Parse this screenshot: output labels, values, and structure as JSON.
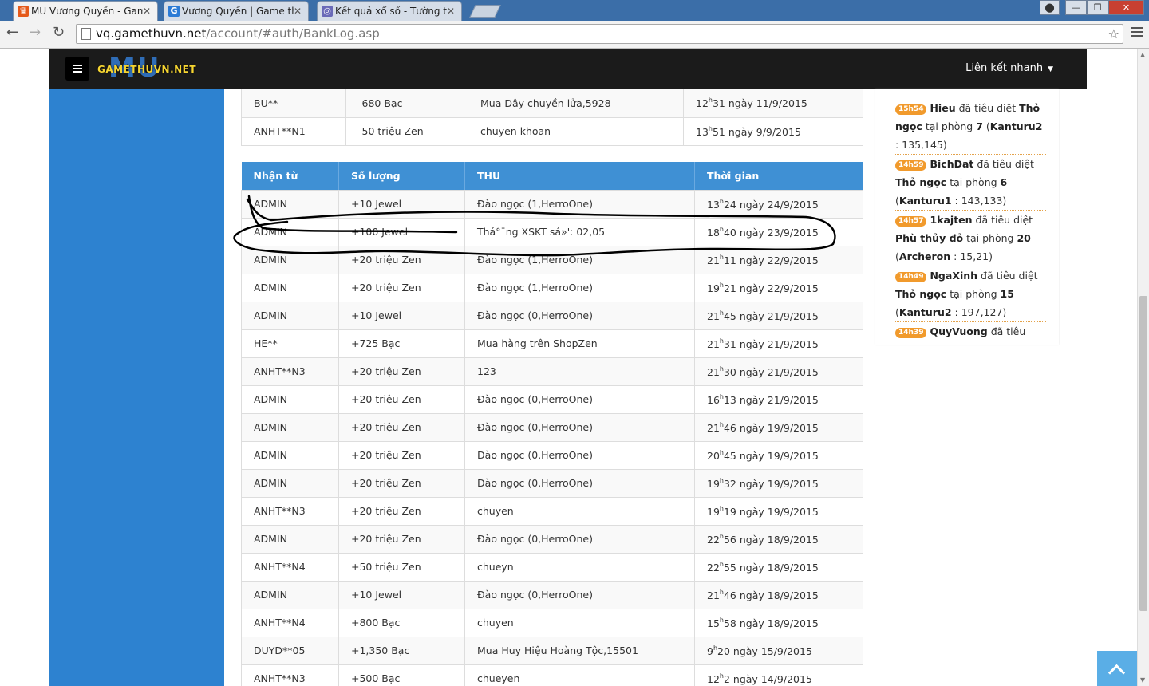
{
  "browser": {
    "tabs": [
      {
        "title": "MU Vương Quyền - Game",
        "favicon_color": "#e55a1a",
        "favicon_glyph": "♛",
        "active": true
      },
      {
        "title": "Vương Quyền | Game thủ",
        "favicon_color": "#2b7bd6",
        "favicon_glyph": "G",
        "active": false
      },
      {
        "title": "Kết quả xổ số - Tường thu",
        "favicon_color": "#6a6ab8",
        "favicon_glyph": "◎",
        "active": false
      }
    ],
    "tab_close": "✕",
    "url_host": "vq.gamethuvn.net",
    "url_path": "/account/#auth/BankLog.asp",
    "window_buttons": {
      "minimize": "—",
      "maximize": "❐",
      "close": "✕"
    },
    "icons": {
      "back": "back-arrow-icon",
      "forward": "forward-arrow-icon",
      "reload": "reload-icon",
      "star": "bookmark-star-icon",
      "menu": "chrome-menu-icon"
    }
  },
  "site": {
    "logo_mu": "MU",
    "logo_text": "GAMETHUVN.NET",
    "quick_links": "Liên kết nhanh",
    "colors": {
      "nav": "#1b1b1b",
      "side_panel": "#2d82d0",
      "table_header": "#3f90d4",
      "badge": "#f19a2c"
    }
  },
  "sent_log": {
    "rows": [
      {
        "user": "BU**",
        "amount": "-680  Bạc",
        "note": "Mua Dây chuyền lửa,5928",
        "hour": "12",
        "min": "31",
        "date": " ngày 11/9/2015"
      },
      {
        "user": "ANHT**N1",
        "amount": "-50  triệu Zen",
        "note": "chuyen khoan",
        "hour": "13",
        "min": "51",
        "date": " ngày 9/9/2015"
      }
    ]
  },
  "received_log": {
    "headers": {
      "from": "Nhận từ",
      "amount": "Số lượng",
      "subject": "THU",
      "time": "Thời gian"
    },
    "rows": [
      {
        "user": "ADMIN",
        "amount": "+10  Jewel",
        "note": "Đào ngọc (1,HerroOne)",
        "hour": "13",
        "min": "24",
        "date": " ngày 24/9/2015"
      },
      {
        "user": "ADMIN",
        "amount": "+100  Jewel",
        "note": "Thá°¯ng XSKT sá»': 02,05",
        "hour": "18",
        "min": "40",
        "date": " ngày 23/9/2015"
      },
      {
        "user": "ADMIN",
        "amount": "+20  triệu Zen",
        "note": "Đào ngọc (1,HerroOne)",
        "hour": "21",
        "min": "11",
        "date": " ngày 22/9/2015"
      },
      {
        "user": "ADMIN",
        "amount": "+20  triệu Zen",
        "note": "Đào ngọc (1,HerroOne)",
        "hour": "19",
        "min": "21",
        "date": " ngày 22/9/2015"
      },
      {
        "user": "ADMIN",
        "amount": "+10  Jewel",
        "note": "Đào ngọc (0,HerroOne)",
        "hour": "21",
        "min": "45",
        "date": " ngày 21/9/2015"
      },
      {
        "user": "HE**",
        "amount": "+725  Bạc",
        "note": "Mua hàng trên ShopZen",
        "hour": "21",
        "min": "31",
        "date": " ngày 21/9/2015"
      },
      {
        "user": "ANHT**N3",
        "amount": "+20  triệu Zen",
        "note": "123",
        "hour": "21",
        "min": "30",
        "date": " ngày 21/9/2015"
      },
      {
        "user": "ADMIN",
        "amount": "+20  triệu Zen",
        "note": "Đào ngọc (0,HerroOne)",
        "hour": "16",
        "min": "13",
        "date": " ngày 21/9/2015"
      },
      {
        "user": "ADMIN",
        "amount": "+20  triệu Zen",
        "note": "Đào ngọc (0,HerroOne)",
        "hour": "21",
        "min": "46",
        "date": " ngày 19/9/2015"
      },
      {
        "user": "ADMIN",
        "amount": "+20  triệu Zen",
        "note": "Đào ngọc (0,HerroOne)",
        "hour": "20",
        "min": "45",
        "date": " ngày 19/9/2015"
      },
      {
        "user": "ADMIN",
        "amount": "+20  triệu Zen",
        "note": "Đào ngọc (0,HerroOne)",
        "hour": "19",
        "min": "32",
        "date": " ngày 19/9/2015"
      },
      {
        "user": "ANHT**N3",
        "amount": "+20  triệu Zen",
        "note": "chuyen",
        "hour": "19",
        "min": "19",
        "date": " ngày 19/9/2015"
      },
      {
        "user": "ADMIN",
        "amount": "+20  triệu Zen",
        "note": "Đào ngọc (0,HerroOne)",
        "hour": "22",
        "min": "56",
        "date": " ngày 18/9/2015"
      },
      {
        "user": "ANHT**N4",
        "amount": "+50  triệu Zen",
        "note": "chueyn",
        "hour": "22",
        "min": "55",
        "date": " ngày 18/9/2015"
      },
      {
        "user": "ADMIN",
        "amount": "+10  Jewel",
        "note": "Đào ngọc (0,HerroOne)",
        "hour": "21",
        "min": "46",
        "date": " ngày 18/9/2015"
      },
      {
        "user": "ANHT**N4",
        "amount": "+800  Bạc",
        "note": "chuyen",
        "hour": "15",
        "min": "58",
        "date": " ngày 18/9/2015"
      },
      {
        "user": "DUYD**05",
        "amount": "+1,350  Bạc",
        "note": "Mua Huy Hiệu Hoàng Tộc,15501",
        "hour": "9",
        "min": "20",
        "date": " ngày 15/9/2015"
      },
      {
        "user": "ANHT**N3",
        "amount": "+500  Bạc",
        "note": "chueyen",
        "hour": "12",
        "min": "2",
        "date": " ngày 14/9/2015"
      }
    ]
  },
  "kill_feed": [
    {
      "time": "15h54",
      "player": "Hieu",
      "verb": " đã tiêu diệt ",
      "boss": "Thỏ ngọc",
      "at": " tại phòng ",
      "room": "7",
      "owner": "Kanturu2",
      "coords": " : 135,145)"
    },
    {
      "time": "14h59",
      "player": "BichDat",
      "verb": " đã tiêu diệt ",
      "boss": "Thỏ ngọc",
      "at": " tại phòng ",
      "room": "6",
      "owner": "Kanturu1",
      "coords": " : 143,133)"
    },
    {
      "time": "14h57",
      "player": "1kajten",
      "verb": " đã tiêu diệt ",
      "boss": "Phù thủy đỏ",
      "at": " tại phòng ",
      "room": "20",
      "owner": "Archeron",
      "coords": " : 15,21)"
    },
    {
      "time": "14h49",
      "player": "NgaXinh",
      "verb": " đã tiêu diệt ",
      "boss": "Thỏ ngọc",
      "at": " tại phòng ",
      "room": "15",
      "owner": "Kanturu2",
      "coords": " : 197,127)"
    },
    {
      "time": "14h39",
      "player": "QuyVuong",
      "verb": " đã tiêu diệt",
      "boss": "",
      "at": "",
      "room": "",
      "owner": "",
      "coords": ""
    }
  ]
}
